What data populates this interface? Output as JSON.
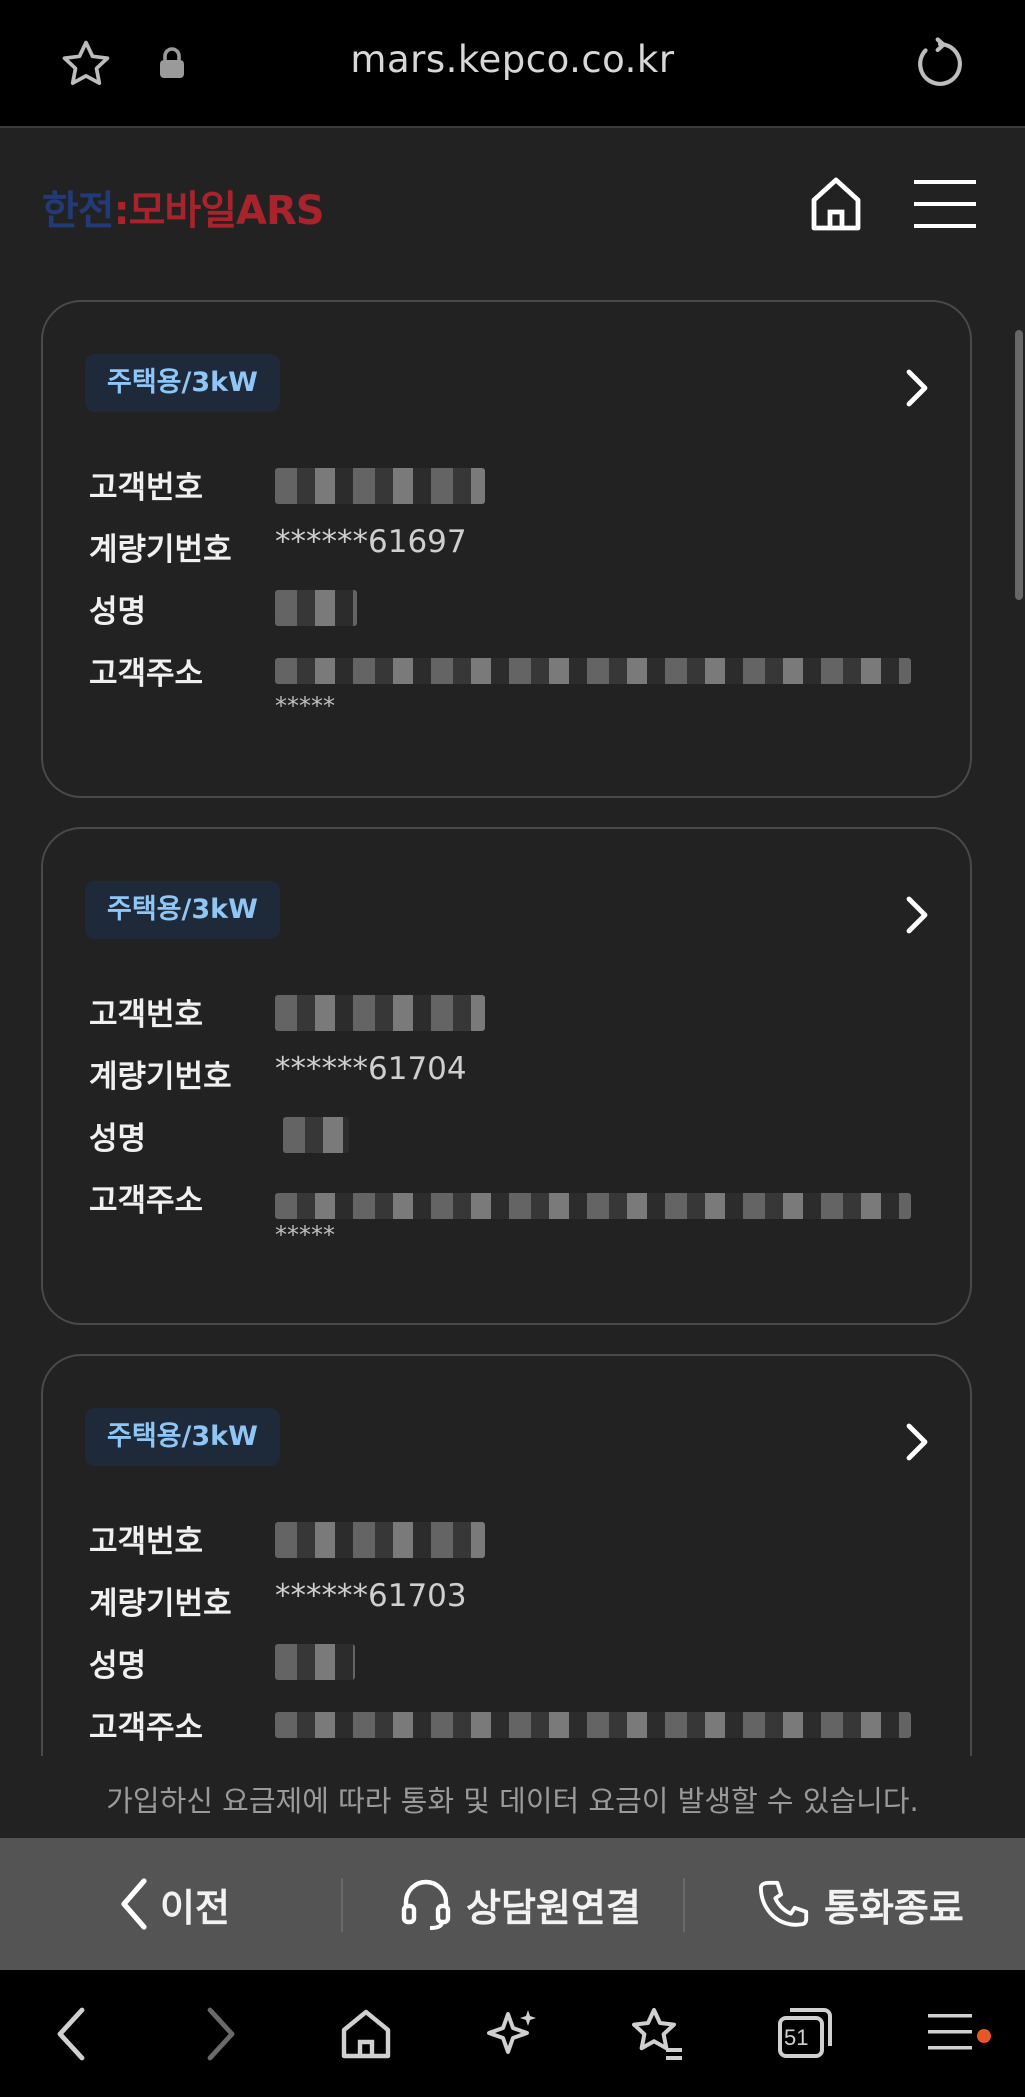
{
  "browser": {
    "url": "mars.kepco.co.kr",
    "tab_count": "51"
  },
  "header": {
    "logo_part1": "한전",
    "logo_part2": ":모바일ARS"
  },
  "labels": {
    "customer_no": "고객번호",
    "meter_no": "계량기번호",
    "name": "성명",
    "address": "고객주소"
  },
  "cards": [
    {
      "badge": "주택용/3kW",
      "meter_no": "******61697",
      "address_masked": "*****"
    },
    {
      "badge": "주택용/3kW",
      "meter_no": "******61704",
      "address_masked": "*****"
    },
    {
      "badge": "주택용/3kW",
      "meter_no": "******61703"
    }
  ],
  "notice": "가입하신 요금제에 따라 통화 및 데이터 요금이 발생할 수 있습니다.",
  "actions": {
    "back": "이전",
    "agent": "상담원연결",
    "end_call": "통화종료"
  },
  "colors": {
    "logo_blue": "#233a78",
    "logo_red": "#a8232b",
    "badge_text": "#8fc6f5",
    "notification_dot": "#e8552a"
  }
}
